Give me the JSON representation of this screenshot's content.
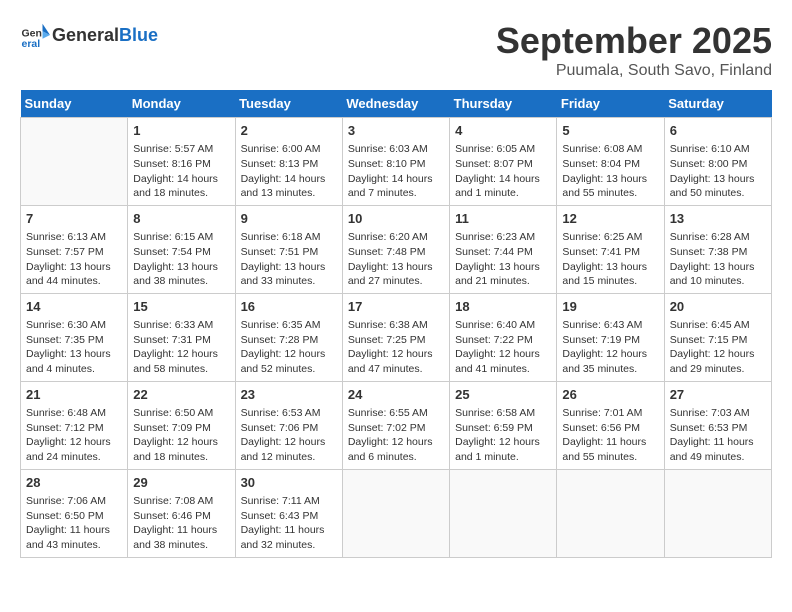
{
  "header": {
    "logo_general": "General",
    "logo_blue": "Blue",
    "month": "September 2025",
    "location": "Puumala, South Savo, Finland"
  },
  "weekdays": [
    "Sunday",
    "Monday",
    "Tuesday",
    "Wednesday",
    "Thursday",
    "Friday",
    "Saturday"
  ],
  "weeks": [
    [
      {
        "day": "",
        "info": ""
      },
      {
        "day": "1",
        "info": "Sunrise: 5:57 AM\nSunset: 8:16 PM\nDaylight: 14 hours\nand 18 minutes."
      },
      {
        "day": "2",
        "info": "Sunrise: 6:00 AM\nSunset: 8:13 PM\nDaylight: 14 hours\nand 13 minutes."
      },
      {
        "day": "3",
        "info": "Sunrise: 6:03 AM\nSunset: 8:10 PM\nDaylight: 14 hours\nand 7 minutes."
      },
      {
        "day": "4",
        "info": "Sunrise: 6:05 AM\nSunset: 8:07 PM\nDaylight: 14 hours\nand 1 minute."
      },
      {
        "day": "5",
        "info": "Sunrise: 6:08 AM\nSunset: 8:04 PM\nDaylight: 13 hours\nand 55 minutes."
      },
      {
        "day": "6",
        "info": "Sunrise: 6:10 AM\nSunset: 8:00 PM\nDaylight: 13 hours\nand 50 minutes."
      }
    ],
    [
      {
        "day": "7",
        "info": "Sunrise: 6:13 AM\nSunset: 7:57 PM\nDaylight: 13 hours\nand 44 minutes."
      },
      {
        "day": "8",
        "info": "Sunrise: 6:15 AM\nSunset: 7:54 PM\nDaylight: 13 hours\nand 38 minutes."
      },
      {
        "day": "9",
        "info": "Sunrise: 6:18 AM\nSunset: 7:51 PM\nDaylight: 13 hours\nand 33 minutes."
      },
      {
        "day": "10",
        "info": "Sunrise: 6:20 AM\nSunset: 7:48 PM\nDaylight: 13 hours\nand 27 minutes."
      },
      {
        "day": "11",
        "info": "Sunrise: 6:23 AM\nSunset: 7:44 PM\nDaylight: 13 hours\nand 21 minutes."
      },
      {
        "day": "12",
        "info": "Sunrise: 6:25 AM\nSunset: 7:41 PM\nDaylight: 13 hours\nand 15 minutes."
      },
      {
        "day": "13",
        "info": "Sunrise: 6:28 AM\nSunset: 7:38 PM\nDaylight: 13 hours\nand 10 minutes."
      }
    ],
    [
      {
        "day": "14",
        "info": "Sunrise: 6:30 AM\nSunset: 7:35 PM\nDaylight: 13 hours\nand 4 minutes."
      },
      {
        "day": "15",
        "info": "Sunrise: 6:33 AM\nSunset: 7:31 PM\nDaylight: 12 hours\nand 58 minutes."
      },
      {
        "day": "16",
        "info": "Sunrise: 6:35 AM\nSunset: 7:28 PM\nDaylight: 12 hours\nand 52 minutes."
      },
      {
        "day": "17",
        "info": "Sunrise: 6:38 AM\nSunset: 7:25 PM\nDaylight: 12 hours\nand 47 minutes."
      },
      {
        "day": "18",
        "info": "Sunrise: 6:40 AM\nSunset: 7:22 PM\nDaylight: 12 hours\nand 41 minutes."
      },
      {
        "day": "19",
        "info": "Sunrise: 6:43 AM\nSunset: 7:19 PM\nDaylight: 12 hours\nand 35 minutes."
      },
      {
        "day": "20",
        "info": "Sunrise: 6:45 AM\nSunset: 7:15 PM\nDaylight: 12 hours\nand 29 minutes."
      }
    ],
    [
      {
        "day": "21",
        "info": "Sunrise: 6:48 AM\nSunset: 7:12 PM\nDaylight: 12 hours\nand 24 minutes."
      },
      {
        "day": "22",
        "info": "Sunrise: 6:50 AM\nSunset: 7:09 PM\nDaylight: 12 hours\nand 18 minutes."
      },
      {
        "day": "23",
        "info": "Sunrise: 6:53 AM\nSunset: 7:06 PM\nDaylight: 12 hours\nand 12 minutes."
      },
      {
        "day": "24",
        "info": "Sunrise: 6:55 AM\nSunset: 7:02 PM\nDaylight: 12 hours\nand 6 minutes."
      },
      {
        "day": "25",
        "info": "Sunrise: 6:58 AM\nSunset: 6:59 PM\nDaylight: 12 hours\nand 1 minute."
      },
      {
        "day": "26",
        "info": "Sunrise: 7:01 AM\nSunset: 6:56 PM\nDaylight: 11 hours\nand 55 minutes."
      },
      {
        "day": "27",
        "info": "Sunrise: 7:03 AM\nSunset: 6:53 PM\nDaylight: 11 hours\nand 49 minutes."
      }
    ],
    [
      {
        "day": "28",
        "info": "Sunrise: 7:06 AM\nSunset: 6:50 PM\nDaylight: 11 hours\nand 43 minutes."
      },
      {
        "day": "29",
        "info": "Sunrise: 7:08 AM\nSunset: 6:46 PM\nDaylight: 11 hours\nand 38 minutes."
      },
      {
        "day": "30",
        "info": "Sunrise: 7:11 AM\nSunset: 6:43 PM\nDaylight: 11 hours\nand 32 minutes."
      },
      {
        "day": "",
        "info": ""
      },
      {
        "day": "",
        "info": ""
      },
      {
        "day": "",
        "info": ""
      },
      {
        "day": "",
        "info": ""
      }
    ]
  ]
}
